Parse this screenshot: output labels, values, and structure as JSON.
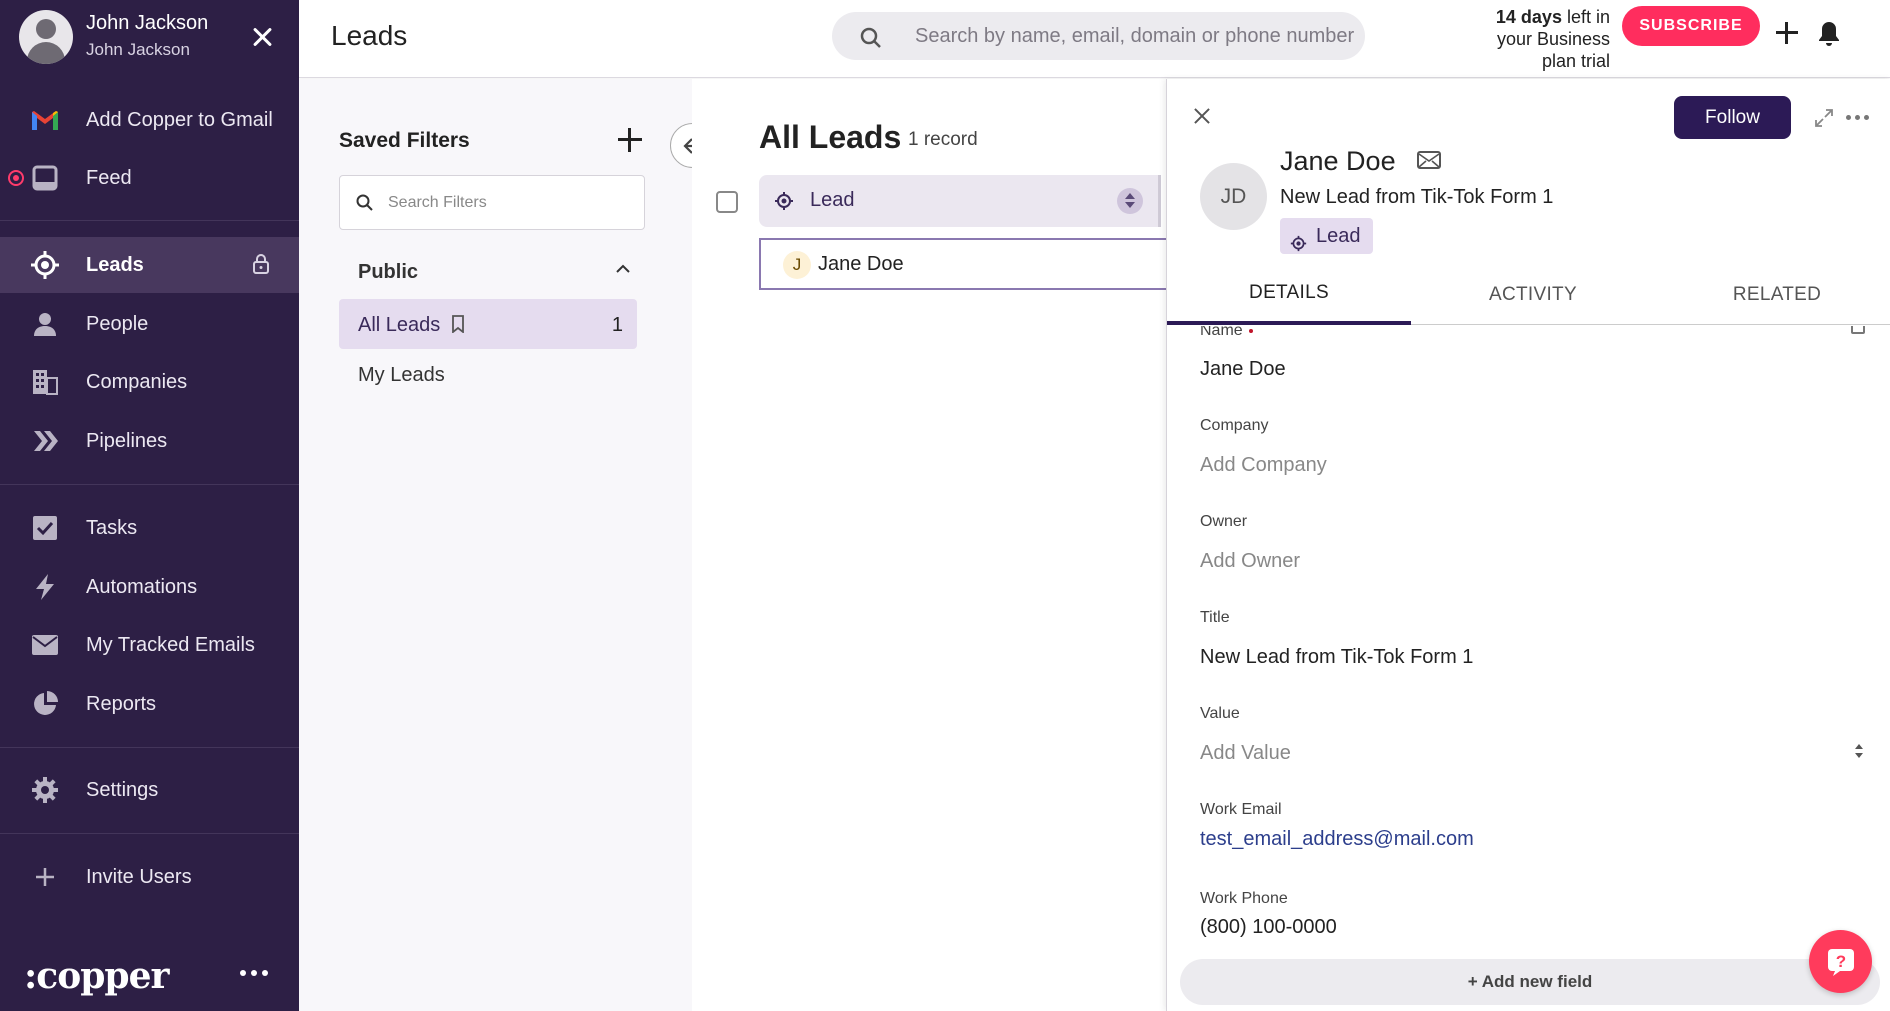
{
  "user": {
    "name": "John Jackson",
    "subtitle": "John Jackson"
  },
  "sidebar": {
    "items": [
      {
        "label": "Add Copper to Gmail",
        "icon": "gmail-icon"
      },
      {
        "label": "Feed",
        "icon": "feed-icon"
      },
      {
        "label": "Leads",
        "icon": "leads-target-icon",
        "active": true
      },
      {
        "label": "People",
        "icon": "person-icon"
      },
      {
        "label": "Companies",
        "icon": "building-icon"
      },
      {
        "label": "Pipelines",
        "icon": "chevrons-icon"
      },
      {
        "label": "Tasks",
        "icon": "checkbox-icon"
      },
      {
        "label": "Automations",
        "icon": "lightning-icon"
      },
      {
        "label": "My Tracked Emails",
        "icon": "envelope-icon"
      },
      {
        "label": "Reports",
        "icon": "pie-chart-icon"
      },
      {
        "label": "Settings",
        "icon": "gear-icon"
      },
      {
        "label": "Invite Users",
        "icon": "plus-icon"
      }
    ],
    "logo": ":copper"
  },
  "header": {
    "title": "Leads",
    "search_placeholder": "Search by name, email, domain or phone number",
    "trial_days": "14 days",
    "trial_rest_1": " left in",
    "trial_rest_2": "your Business",
    "trial_rest_3": "plan trial",
    "subscribe_label": "SUBSCRIBE"
  },
  "filters": {
    "title": "Saved Filters",
    "search_placeholder": "Search Filters",
    "group": "Public",
    "items": [
      {
        "label": "All Leads",
        "count": "1",
        "active": true
      },
      {
        "label": "My Leads"
      }
    ]
  },
  "list": {
    "title": "All Leads",
    "count_label": "1 record",
    "column": "Lead",
    "rows": [
      {
        "initial": "J",
        "name": "Jane Doe"
      }
    ]
  },
  "detail": {
    "initials": "JD",
    "name": "Jane Doe",
    "subtitle": "New Lead from Tik-Tok Form 1",
    "badge": "Lead",
    "follow_label": "Follow",
    "tabs": [
      "DETAILS",
      "ACTIVITY",
      "RELATED"
    ],
    "fields": {
      "name_label": "Name",
      "name_value": "Jane Doe",
      "company_label": "Company",
      "company_value": "Add Company",
      "owner_label": "Owner",
      "owner_value": "Add Owner",
      "title_label": "Title",
      "title_value": "New Lead from Tik-Tok Form 1",
      "value_label": "Value",
      "value_value": "Add Value",
      "work_email_label": "Work Email",
      "work_email_value": "test_email_address@mail.com",
      "work_phone_label": "Work Phone",
      "work_phone_value": "(800) 100-0000"
    },
    "add_field_label": "+ Add new field"
  },
  "colors": {
    "sidebar": "#2d1f45",
    "accent": "#2c1a56",
    "subscribe": "#ff2d5e",
    "active_filter": "#e5dcef"
  }
}
